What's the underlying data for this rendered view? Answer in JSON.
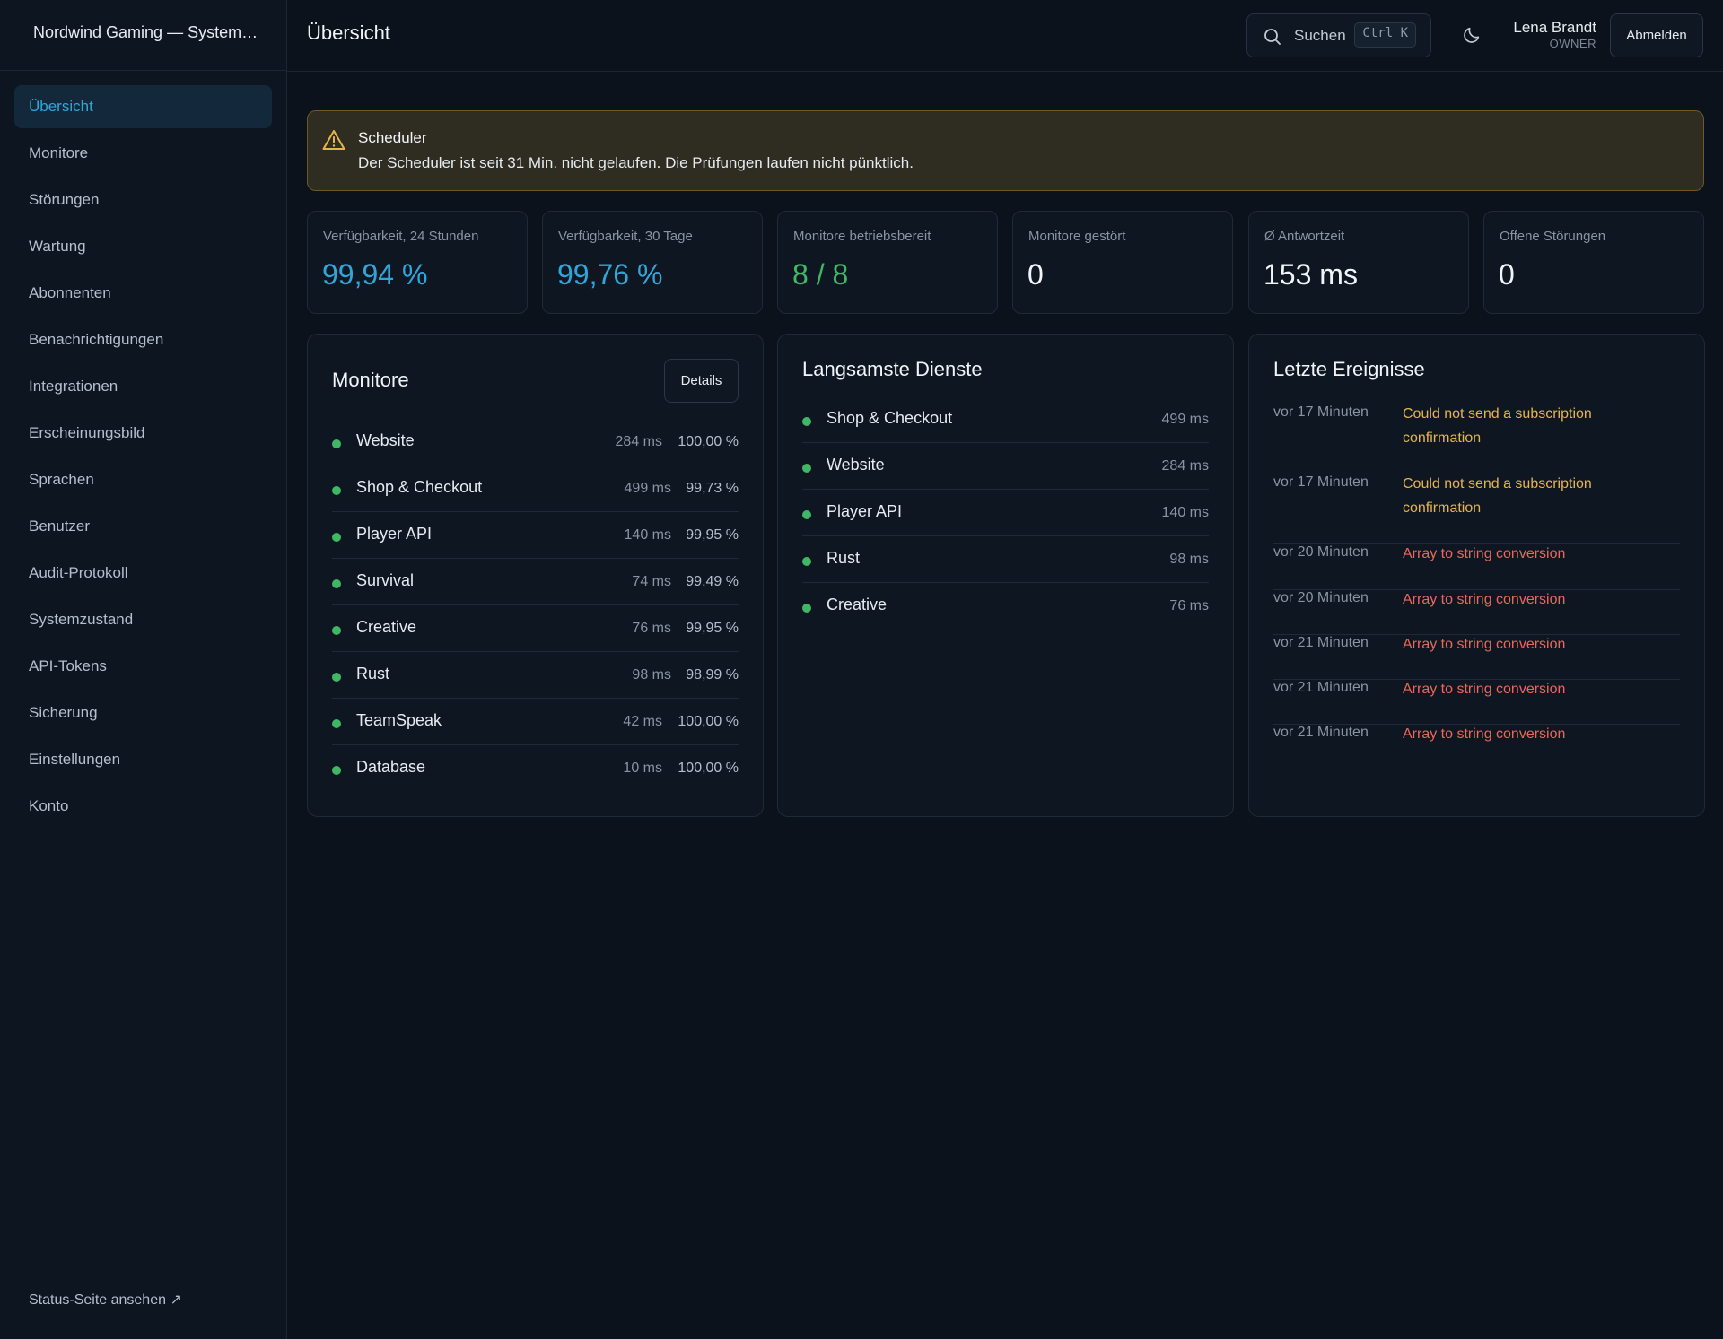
{
  "app": {
    "brand": "Nordwind Gaming — System…",
    "page_title": "Übersicht"
  },
  "sidebar": {
    "items": [
      {
        "label": "Übersicht",
        "active": true
      },
      {
        "label": "Monitore"
      },
      {
        "label": "Störungen"
      },
      {
        "label": "Wartung"
      },
      {
        "label": "Abonnenten"
      },
      {
        "label": "Benachrichtigungen"
      },
      {
        "label": "Integrationen"
      },
      {
        "label": "Erscheinungsbild"
      },
      {
        "label": "Sprachen"
      },
      {
        "label": "Benutzer"
      },
      {
        "label": "Audit-Protokoll"
      },
      {
        "label": "Systemzustand"
      },
      {
        "label": "API-Tokens"
      },
      {
        "label": "Sicherung"
      },
      {
        "label": "Einstellungen"
      },
      {
        "label": "Konto"
      }
    ],
    "footer_link": "Status-Seite ansehen ↗"
  },
  "header": {
    "search_label": "Suchen",
    "search_shortcut": "Ctrl K",
    "theme_icon": "moon-icon",
    "user_name": "Lena Brandt",
    "user_role": "OWNER",
    "logout_label": "Abmelden"
  },
  "alert": {
    "icon": "warning-icon",
    "title": "Scheduler",
    "text": "Der Scheduler ist seit 31 Min. nicht gelaufen. Die Prüfungen laufen nicht pünktlich.",
    "color": "#e5b54a"
  },
  "kpis": [
    {
      "label": "Verfügbarkeit, 24 Stunden",
      "value": "99,94 %",
      "tone": "blue"
    },
    {
      "label": "Verfügbarkeit, 30 Tage",
      "value": "99,76 %",
      "tone": "blue"
    },
    {
      "label": "Monitore betriebsbereit",
      "value": "8 / 8",
      "tone": "green"
    },
    {
      "label": "Monitore gestört",
      "value": "0",
      "tone": ""
    },
    {
      "label": "Ø Antwortzeit",
      "value": "153 ms",
      "tone": ""
    },
    {
      "label": "Offene Störungen",
      "value": "0",
      "tone": ""
    }
  ],
  "monitors": {
    "title": "Monitore",
    "details_label": "Details",
    "rows": [
      {
        "name": "Website",
        "ms": "284 ms",
        "pct": "100,00 %"
      },
      {
        "name": "Shop & Checkout",
        "ms": "499 ms",
        "pct": "99,73 %"
      },
      {
        "name": "Player API",
        "ms": "140 ms",
        "pct": "99,95 %"
      },
      {
        "name": "Survival",
        "ms": "74 ms",
        "pct": "99,49 %"
      },
      {
        "name": "Creative",
        "ms": "76 ms",
        "pct": "99,95 %"
      },
      {
        "name": "Rust",
        "ms": "98 ms",
        "pct": "98,99 %"
      },
      {
        "name": "TeamSpeak",
        "ms": "42 ms",
        "pct": "100,00 %"
      },
      {
        "name": "Database",
        "ms": "10 ms",
        "pct": "100,00 %"
      }
    ]
  },
  "slowest": {
    "title": "Langsamste Dienste",
    "rows": [
      {
        "name": "Shop & Checkout",
        "ms": "499 ms"
      },
      {
        "name": "Website",
        "ms": "284 ms"
      },
      {
        "name": "Player API",
        "ms": "140 ms"
      },
      {
        "name": "Rust",
        "ms": "98 ms"
      },
      {
        "name": "Creative",
        "ms": "76 ms"
      }
    ]
  },
  "events": {
    "title": "Letzte Ereignisse",
    "rows": [
      {
        "time": "vor 17 Minuten",
        "msg": "Could not send a subscription confirmation",
        "level": "warn"
      },
      {
        "time": "vor 17 Minuten",
        "msg": "Could not send a subscription confirmation",
        "level": "warn"
      },
      {
        "time": "vor 20 Minuten",
        "msg": "Array to string conversion",
        "level": "err"
      },
      {
        "time": "vor 20 Minuten",
        "msg": "Array to string conversion",
        "level": "err"
      },
      {
        "time": "vor 21 Minuten",
        "msg": "Array to string conversion",
        "level": "err"
      },
      {
        "time": "vor 21 Minuten",
        "msg": "Array to string conversion",
        "level": "err"
      },
      {
        "time": "vor 21 Minuten",
        "msg": "Array to string conversion",
        "level": "err"
      }
    ]
  },
  "colors": {
    "background": "#0b121c",
    "accent_blue": "#2ea6d9",
    "status_green": "#3fb764",
    "warning": "#e5b54a",
    "error": "#e8685a"
  }
}
